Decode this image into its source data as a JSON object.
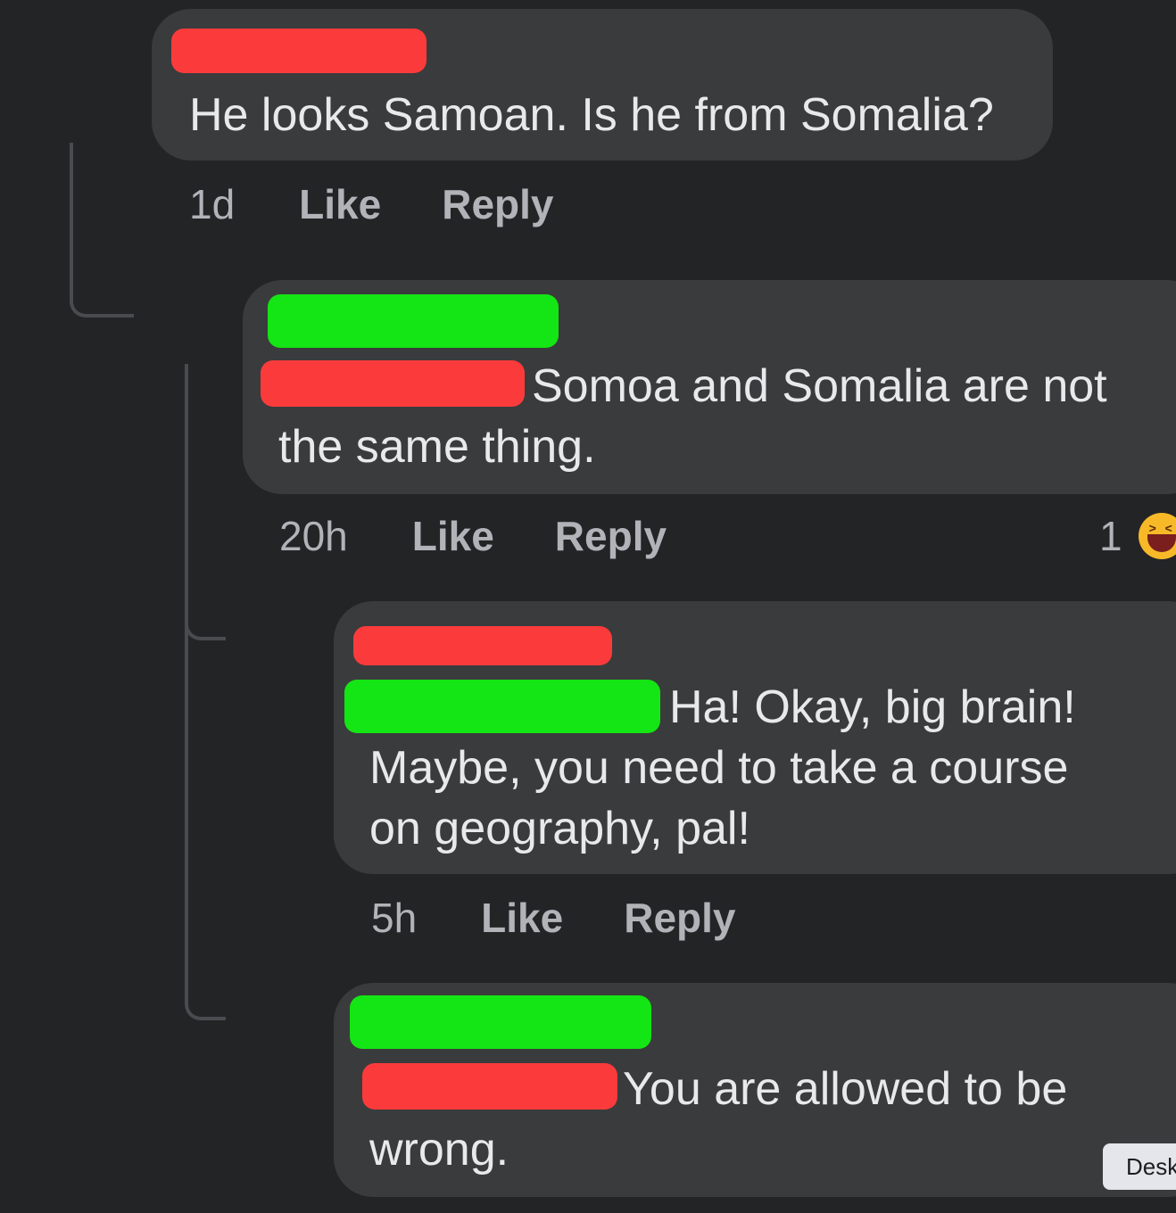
{
  "comments": [
    {
      "text_lines": [
        "He looks Samoan. Is he from Somalia?"
      ],
      "time": "1d",
      "like_label": "Like",
      "reply_label": "Reply"
    },
    {
      "text_lines": [
        "Somoa and Somalia are not",
        "the same thing."
      ],
      "time": "20h",
      "like_label": "Like",
      "reply_label": "Reply",
      "reaction_count": "1",
      "reaction_icon": "laughing-emoji-icon"
    },
    {
      "text_lines": [
        "Ha! Okay, big brain!",
        "Maybe, you need to take a course",
        "on geography, pal!"
      ],
      "time": "5h",
      "like_label": "Like",
      "reply_label": "Reply"
    },
    {
      "text_lines": [
        "You are allowed to be",
        "wrong."
      ]
    }
  ],
  "tooltip": {
    "text": "Desk"
  },
  "colors": {
    "background": "#232426",
    "bubble": "#3a3b3c",
    "redaction_red": "#fb3b3b",
    "redaction_green": "#14e514",
    "meta_text": "#b0b3b8"
  }
}
